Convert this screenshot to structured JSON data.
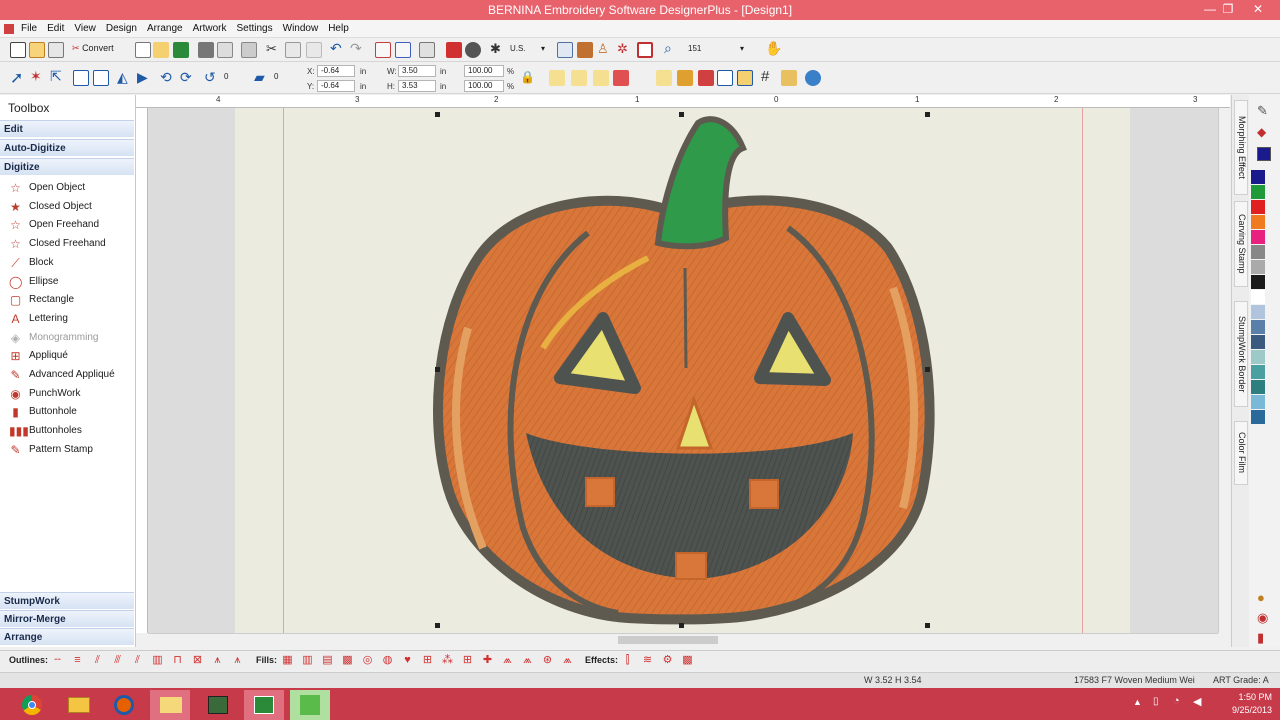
{
  "window": {
    "title": "BERNINA Embroidery Software DesignerPlus - [Design1]"
  },
  "menu": [
    "File",
    "Edit",
    "View",
    "Design",
    "Arrange",
    "Artwork",
    "Settings",
    "Window",
    "Help"
  ],
  "toolbar1": {
    "convert_label": "Convert",
    "units": "U.S.",
    "zoom": "151"
  },
  "toolbar2": {
    "rotate_value": "0",
    "slant_value": "0",
    "x_label": "X:",
    "x_value": "-0.64",
    "x_unit": "in",
    "y_label": "Y:",
    "y_value": "-0.64",
    "y_unit": "in",
    "w_label": "W:",
    "w_value": "3.50",
    "w_unit": "in",
    "h_label": "H:",
    "h_value": "3.53",
    "h_unit": "in",
    "scale_x": "100.00",
    "scale_y": "100.00",
    "pct": "%"
  },
  "toolbox": {
    "title": "Toolbox",
    "sections_top": [
      "Edit",
      "Auto-Digitize",
      "Digitize"
    ],
    "tools": [
      {
        "label": "Open Object",
        "icon": "star-outline-icon",
        "glyph": "☆"
      },
      {
        "label": "Closed Object",
        "icon": "star-filled-icon",
        "glyph": "★"
      },
      {
        "label": "Open Freehand",
        "icon": "open-freehand-icon",
        "glyph": "☆"
      },
      {
        "label": "Closed Freehand",
        "icon": "closed-freehand-icon",
        "glyph": "☆"
      },
      {
        "label": "Block",
        "icon": "block-icon",
        "glyph": "⟋"
      },
      {
        "label": "Ellipse",
        "icon": "ellipse-icon",
        "glyph": "◯"
      },
      {
        "label": "Rectangle",
        "icon": "rectangle-icon",
        "glyph": "▢"
      },
      {
        "label": "Lettering",
        "icon": "lettering-icon",
        "glyph": "A"
      },
      {
        "label": "Monogramming",
        "icon": "monogram-icon",
        "glyph": "◈",
        "disabled": true
      },
      {
        "label": "Appliqué",
        "icon": "applique-icon",
        "glyph": "⊞"
      },
      {
        "label": "Advanced Appliqué",
        "icon": "advanced-applique-icon",
        "glyph": "✎"
      },
      {
        "label": "PunchWork",
        "icon": "punchwork-icon",
        "glyph": "◉"
      },
      {
        "label": "Buttonhole",
        "icon": "buttonhole-icon",
        "glyph": "▮"
      },
      {
        "label": "Buttonholes",
        "icon": "buttonholes-icon",
        "glyph": "▮▮▮"
      },
      {
        "label": "Pattern Stamp",
        "icon": "pattern-stamp-icon",
        "glyph": "✎"
      }
    ],
    "sections_bottom": [
      "StumpWork",
      "Mirror-Merge",
      "Arrange"
    ]
  },
  "ruler": {
    "top_labels": [
      "4",
      "3",
      "2",
      "1",
      "0",
      "1",
      "2",
      "3"
    ]
  },
  "docker_tabs": [
    "Morphing Effect",
    "Carving Stamp",
    "StumpWork Border",
    "Color Film"
  ],
  "palette_colors": [
    "#1a1a8c",
    "#1f9a3a",
    "#e02020",
    "#f07a20",
    "#e82080",
    "#888888",
    "#aaaaaa",
    "#1a1a1a",
    "#ffffff",
    "#b0c4de",
    "#5a7fa8",
    "#3a5a80",
    "#9ec9c9",
    "#4aa0a0",
    "#2d7f7f",
    "#7ab8d8",
    "#2a6a9a"
  ],
  "bottom_toolbar": {
    "outlines_label": "Outlines:",
    "fills_label": "Fills:",
    "effects_label": "Effects:"
  },
  "status": {
    "dimensions": "W 3.52 H 3.54",
    "fabric": "17583 F7 Woven Medium Wei",
    "grade": "ART Grade: A"
  },
  "taskbar": {
    "time": "1:50 PM",
    "date": "9/25/2013"
  },
  "colors": {
    "title_bar": "#e8626c",
    "taskbar": "#c63a4a",
    "pumpkin": "#d9773a",
    "stem": "#2f9a4a",
    "outline": "#5f5a50",
    "mouth": "#4f5350",
    "eyes": "#e8e070"
  }
}
